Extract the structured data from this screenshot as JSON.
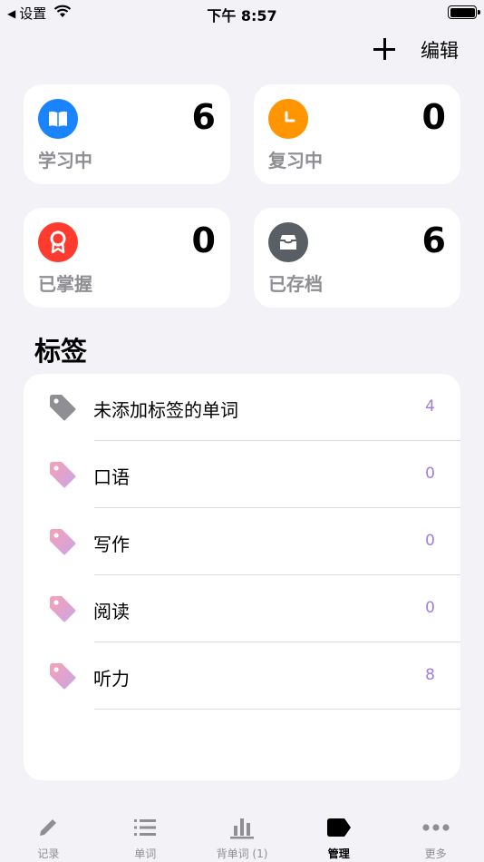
{
  "status_bar": {
    "back_label": "设置",
    "time": "下午 8:57"
  },
  "nav": {
    "add_icon": "plus-icon",
    "edit_label": "编辑"
  },
  "stats": [
    {
      "label": "学习中",
      "count": "6",
      "icon": "book-icon",
      "color": "#1a84ff"
    },
    {
      "label": "复习中",
      "count": "0",
      "icon": "clock-icon",
      "color": "#ff9500"
    },
    {
      "label": "已掌握",
      "count": "0",
      "icon": "award-icon",
      "color": "#ff3b30"
    },
    {
      "label": "已存档",
      "count": "6",
      "icon": "archive-icon",
      "color": "#5a5f66"
    }
  ],
  "tags_section": {
    "title": "标签",
    "items": [
      {
        "label": "未添加标签的单词",
        "count": "4"
      },
      {
        "label": "口语",
        "count": "0"
      },
      {
        "label": "写作",
        "count": "0"
      },
      {
        "label": "阅读",
        "count": "0"
      },
      {
        "label": "听力",
        "count": "8"
      }
    ]
  },
  "tab_bar": {
    "items": [
      {
        "label": "记录",
        "icon": "pencil-icon"
      },
      {
        "label": "单词",
        "icon": "list-icon"
      },
      {
        "label": "背单词 (1)",
        "icon": "bar-chart-icon"
      },
      {
        "label": "管理",
        "icon": "tag-icon"
      },
      {
        "label": "更多",
        "icon": "more-icon"
      }
    ],
    "active_index": 3
  }
}
